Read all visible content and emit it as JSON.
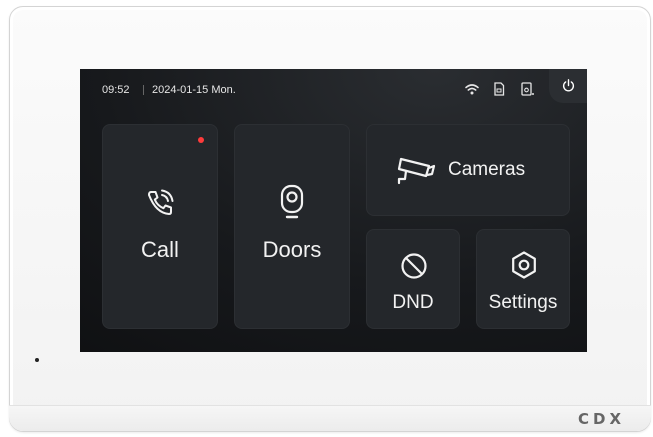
{
  "status": {
    "time": "09:52",
    "date": "2024-01-15",
    "day": "Mon.",
    "icons": [
      "wifi-icon",
      "sd-card-icon",
      "door-sensor-icon"
    ]
  },
  "power": {
    "icon": "power-icon"
  },
  "tiles": {
    "call": {
      "label": "Call",
      "icon": "phone-call-icon",
      "notification": true,
      "badge_color": "#ff3b3b"
    },
    "doors": {
      "label": "Doors",
      "icon": "doorbell-camera-icon"
    },
    "cameras": {
      "label": "Cameras",
      "icon": "security-camera-icon"
    },
    "dnd": {
      "label": "DND",
      "icon": "do-not-disturb-icon"
    },
    "settings": {
      "label": "Settings",
      "icon": "gear-hexagon-icon"
    }
  },
  "brand": "CDX",
  "colors": {
    "screen_bg": "#17191c",
    "tile_bg": "#24272b",
    "text": "#f2f2f2",
    "badge": "#ff3b3b"
  }
}
